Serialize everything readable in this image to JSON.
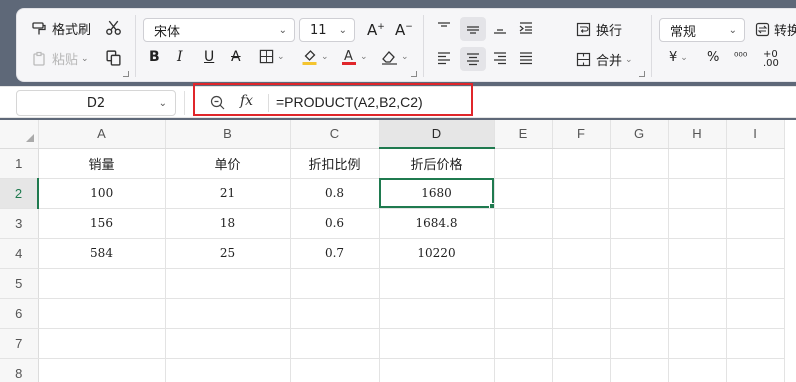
{
  "ribbon": {
    "format_painter_label": "格式刷",
    "paste_label": "粘贴",
    "font_name": "宋体",
    "font_size": "11",
    "wrap_label": "换行",
    "merge_label": "合并",
    "number_format": "常规",
    "convert_label": "转换",
    "icons": [
      "scissors-icon",
      "copy-icon",
      "bold-icon",
      "italic-icon",
      "underline-icon",
      "strikethrough-icon",
      "borders-icon",
      "fill-color-icon",
      "font-color-icon",
      "clear-format-icon",
      "increase-font-icon",
      "decrease-font-icon",
      "align-top-icon",
      "align-middle-icon",
      "align-bottom-icon",
      "align-left-icon",
      "align-center-icon",
      "align-right-icon",
      "indent-icon",
      "wrap-icon",
      "merge-icon",
      "currency-icon",
      "percent-icon",
      "thousands-icon",
      "decimal-icon"
    ],
    "accent_fill": "#f4c430",
    "accent_font": "#e0262b"
  },
  "formula_bar": {
    "name_box": "D2",
    "fx_label": "fx",
    "formula": "=PRODUCT(A2,B2,C2)"
  },
  "highlight_color": "#e0262b",
  "grid": {
    "columns": [
      "A",
      "B",
      "C",
      "D",
      "E",
      "F",
      "G",
      "H",
      "I"
    ],
    "rows": [
      "1",
      "2",
      "3",
      "4",
      "5",
      "6",
      "7",
      "8"
    ],
    "cells": [
      [
        "销量",
        "单价",
        "折扣比例",
        "折后价格",
        "",
        "",
        "",
        "",
        ""
      ],
      [
        "100",
        "21",
        "0.8",
        "1680",
        "",
        "",
        "",
        "",
        ""
      ],
      [
        "156",
        "18",
        "0.6",
        "1684.8",
        "",
        "",
        "",
        "",
        ""
      ],
      [
        "584",
        "25",
        "0.7",
        "10220",
        "",
        "",
        "",
        "",
        ""
      ],
      [
        "",
        "",
        "",
        "",
        "",
        "",
        "",
        "",
        ""
      ],
      [
        "",
        "",
        "",
        "",
        "",
        "",
        "",
        "",
        ""
      ],
      [
        "",
        "",
        "",
        "",
        "",
        "",
        "",
        "",
        ""
      ],
      [
        "",
        "",
        "",
        "",
        "",
        "",
        "",
        "",
        ""
      ]
    ],
    "active_cell": "D2",
    "selection_color": "#1f7a4f"
  }
}
